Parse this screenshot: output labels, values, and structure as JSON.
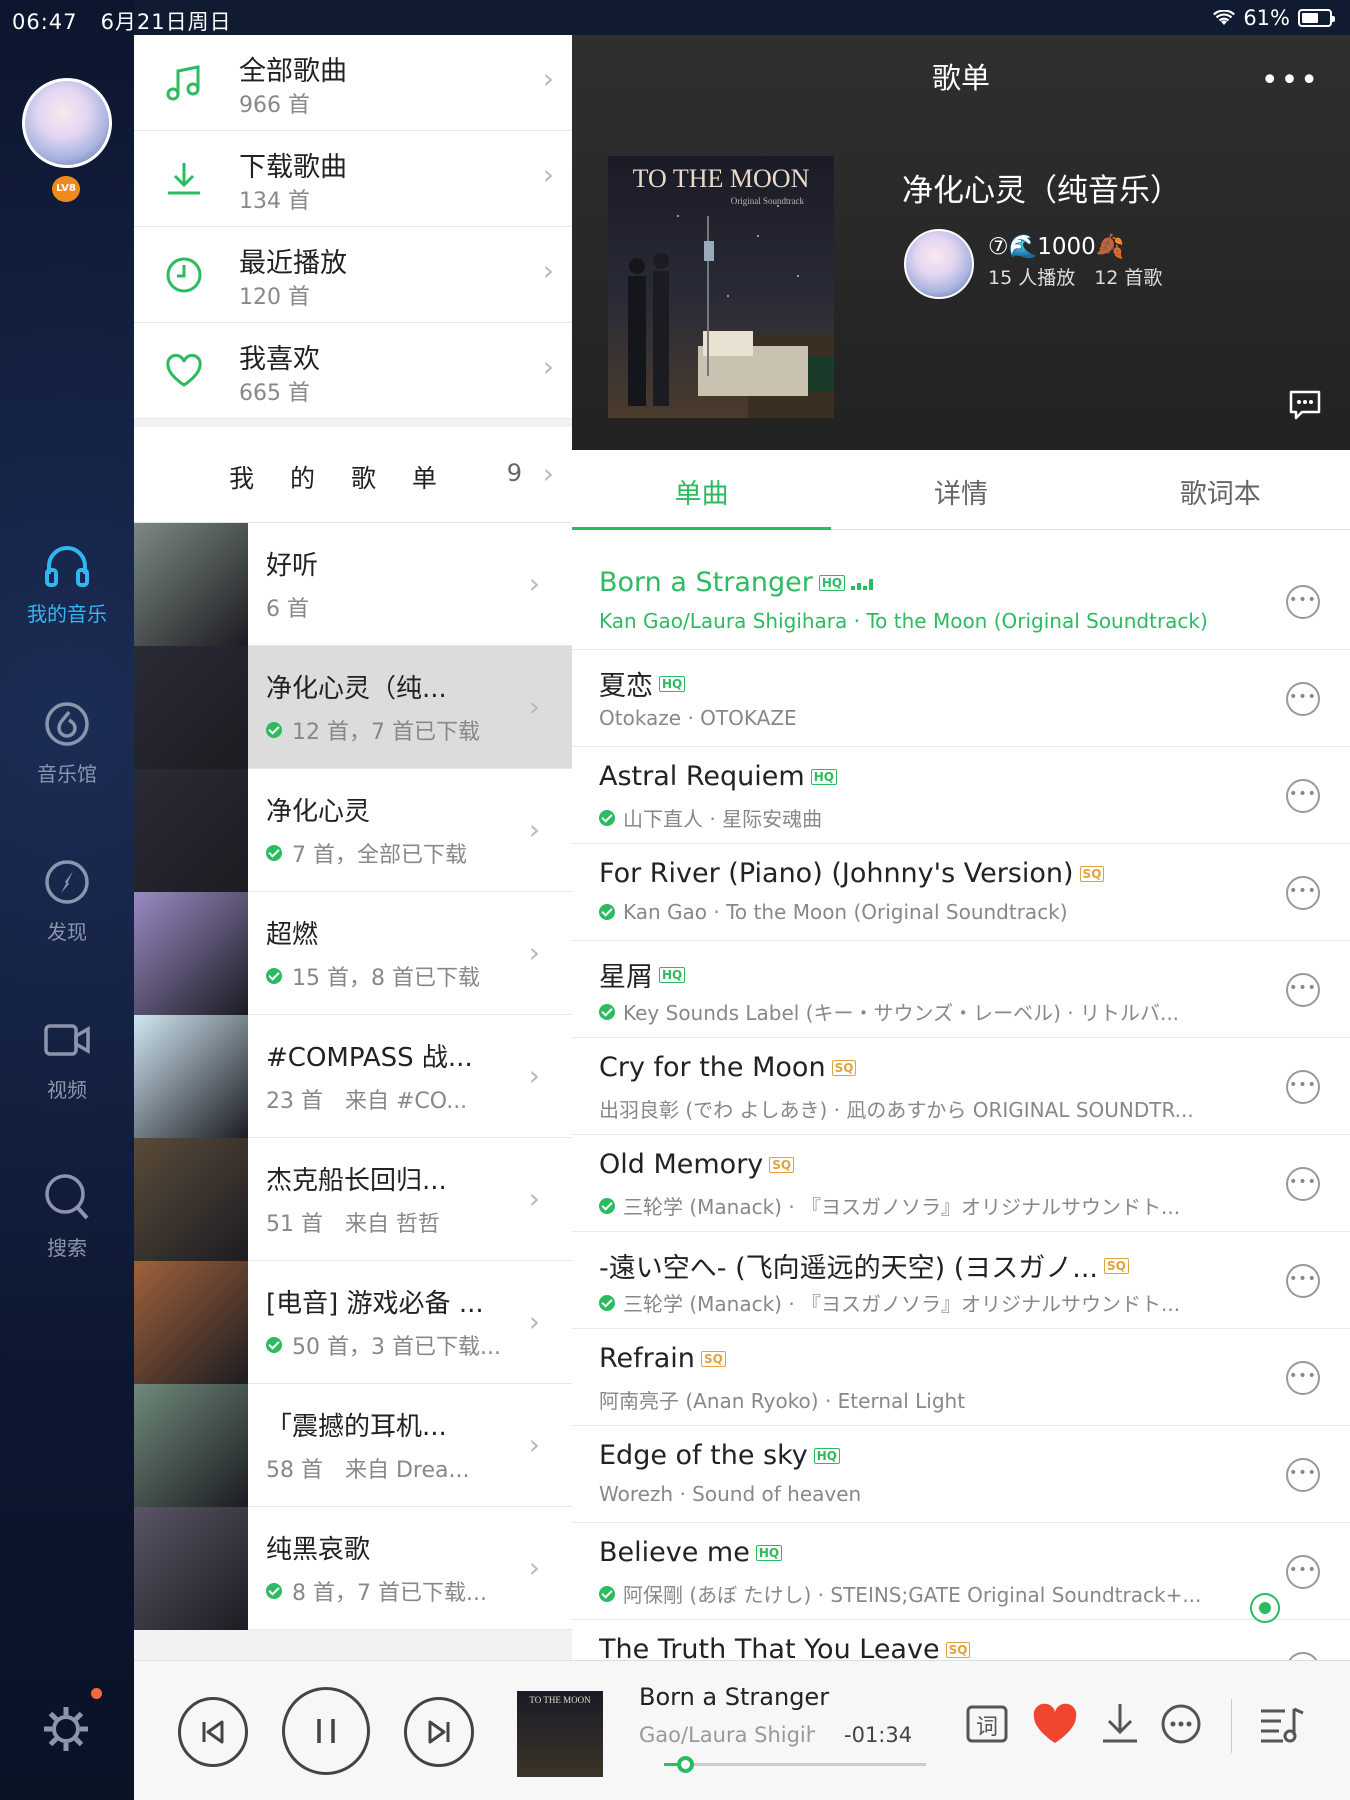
{
  "status": {
    "time": "06:47",
    "date": "6月21日周日",
    "battery": "61%"
  },
  "rail": {
    "level_badge": "LV8",
    "nav": [
      {
        "label": "我的音乐",
        "active": true
      },
      {
        "label": "音乐馆",
        "active": false
      },
      {
        "label": "发现",
        "active": false
      },
      {
        "label": "视频",
        "active": false
      },
      {
        "label": "搜索",
        "active": false
      }
    ]
  },
  "quick": [
    {
      "title": "全部歌曲",
      "sub": "966 首",
      "icon": "music-note-icon"
    },
    {
      "title": "下载歌曲",
      "sub": "134 首",
      "icon": "download-icon"
    },
    {
      "title": "最近播放",
      "sub": "120 首",
      "icon": "clock-icon"
    },
    {
      "title": "我喜欢",
      "sub": "665 首",
      "icon": "heart-icon"
    }
  ],
  "my_playlists": {
    "title": "我 的 歌 单",
    "count": "9",
    "items": [
      {
        "title": "好听",
        "sub": "6 首",
        "downloaded": false,
        "cover": "#7d8a82"
      },
      {
        "title": "净化心灵（纯...",
        "sub": "12 首，7 首已下载",
        "downloaded": true,
        "selected": true,
        "cover": "#2a2b35"
      },
      {
        "title": "净化心灵",
        "sub": "7 首，全部已下载",
        "downloaded": true,
        "cover": "#2a2b35"
      },
      {
        "title": "超燃",
        "sub": "15 首，8 首已下载",
        "downloaded": true,
        "cover": "#9a8ac4"
      },
      {
        "title": "#COMPASS 战...",
        "sub": "23 首　来自 #CO...",
        "downloaded": false,
        "cover": "#cfe7f2"
      },
      {
        "title": "杰克船长回归...",
        "sub": "51 首　来自 哲哲",
        "downloaded": false,
        "cover": "#5a4b38"
      },
      {
        "title": "[电音] 游戏必备 ...",
        "sub": "50 首，3 首已下载...",
        "downloaded": true,
        "cover": "#a0623a"
      },
      {
        "title": "「震撼的耳机...",
        "sub": "58 首　来自 Drea...",
        "downloaded": false,
        "cover": "#6f8a7a"
      },
      {
        "title": "纯黑哀歌",
        "sub": "8 首，7 首已下载...",
        "downloaded": true,
        "cover": "#5a5566"
      }
    ]
  },
  "header": {
    "title": "歌单",
    "more": "•••",
    "cover_title": "TO THE MOON",
    "cover_sub": "Original Soundtrack",
    "playlist_name": "净化心灵（纯音乐）",
    "creator_badge": "⑦🌊1000🍂",
    "stats": "15 人播放　12 首歌"
  },
  "tabs": [
    {
      "label": "单曲",
      "active": true
    },
    {
      "label": "详情",
      "active": false
    },
    {
      "label": "歌词本",
      "active": false
    }
  ],
  "songs": [
    {
      "title": "Born a Stranger",
      "quality": "HQ",
      "sub": "Kan Gao/Laura Shigihara · To the Moon (Original Soundtrack)",
      "downloaded": false,
      "playing": true
    },
    {
      "title": "夏恋",
      "quality": "HQ",
      "sub": "Otokaze · OTOKAZE",
      "downloaded": false
    },
    {
      "title": "Astral Requiem",
      "quality": "HQ",
      "sub": "山下直人 · 星际安魂曲",
      "downloaded": true
    },
    {
      "title": "For River (Piano) (Johnny's Version)",
      "quality": "SQ",
      "sub": "Kan Gao · To the Moon (Original Soundtrack)",
      "downloaded": true
    },
    {
      "title": "星屑",
      "quality": "HQ",
      "sub": "Key Sounds Label (キー・サウンズ・レーベル) · リトルバ...",
      "downloaded": true
    },
    {
      "title": "Cry for the Moon",
      "quality": "SQ",
      "sub": "出羽良彰 (でわ よしあき) · 凪のあすから ORIGINAL SOUNDTR...",
      "downloaded": false
    },
    {
      "title": "Old Memory",
      "quality": "SQ",
      "sub": "三轮学 (Manack) · 『ヨスガノソラ』オリジナルサウンドト...",
      "downloaded": true
    },
    {
      "title": "-遠い空へ- (飞向遥远的天空) (ヨスガノ...",
      "quality": "SQ",
      "sub": "三轮学 (Manack) · 『ヨスガノソラ』オリジナルサウンドト...",
      "downloaded": true
    },
    {
      "title": "Refrain",
      "quality": "SQ",
      "sub": "阿南亮子 (Anan Ryoko) · Eternal Light",
      "downloaded": false
    },
    {
      "title": "Edge of the sky",
      "quality": "HQ",
      "sub": "Worezh · Sound of heaven",
      "downloaded": false
    },
    {
      "title": "Believe me",
      "quality": "HQ",
      "sub": "阿保剛 (あぼ たけし) · STEINS;GATE Original Soundtrack+...",
      "downloaded": true
    },
    {
      "title": "The Truth That You Leave",
      "quality": "SQ",
      "sub": "",
      "downloaded": false
    }
  ],
  "player": {
    "title": "Born a Stranger",
    "artist": "Gao/Laura Shigihara",
    "remaining": "-01:34",
    "progress": 0.08,
    "cover_title": "TO THE MOON",
    "lyrics_label": "词",
    "liked": true
  },
  "colors": {
    "accent": "#2dbb61",
    "rail_active": "#31b7f0",
    "heart": "#f0452e"
  }
}
